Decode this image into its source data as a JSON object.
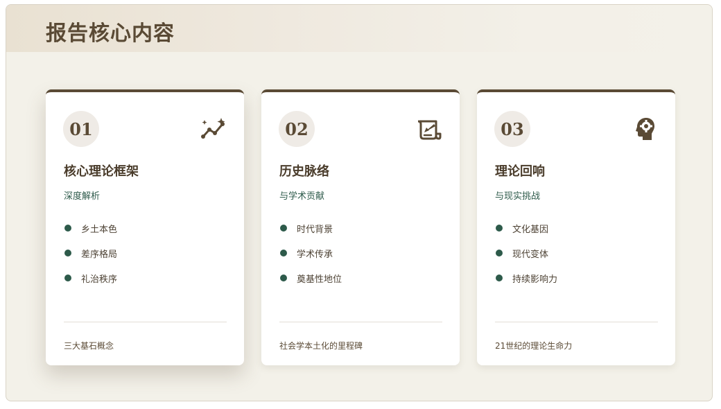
{
  "page": {
    "title": "报告核心内容"
  },
  "colors": {
    "brand_brown": "#5a4a35",
    "accent_green": "#2d5a4a",
    "background": "#f3f1e9"
  },
  "cards": [
    {
      "number": "01",
      "icon": "sparkle-chart-icon",
      "title": "核心理论框架",
      "subtitle": "深度解析",
      "items": [
        "乡土本色",
        "差序格局",
        "礼治秩序"
      ],
      "footer": "三大基石概念"
    },
    {
      "number": "02",
      "icon": "scroll-quill-icon",
      "title": "历史脉络",
      "subtitle": "与学术贡献",
      "items": [
        "时代背景",
        "学术传承",
        "奠基性地位"
      ],
      "footer": "社会学本土化的里程碑"
    },
    {
      "number": "03",
      "icon": "head-gear-icon",
      "title": "理论回响",
      "subtitle": "与现实挑战",
      "items": [
        "文化基因",
        "现代变体",
        "持续影响力"
      ],
      "footer": "21世纪的理论生命力"
    }
  ]
}
